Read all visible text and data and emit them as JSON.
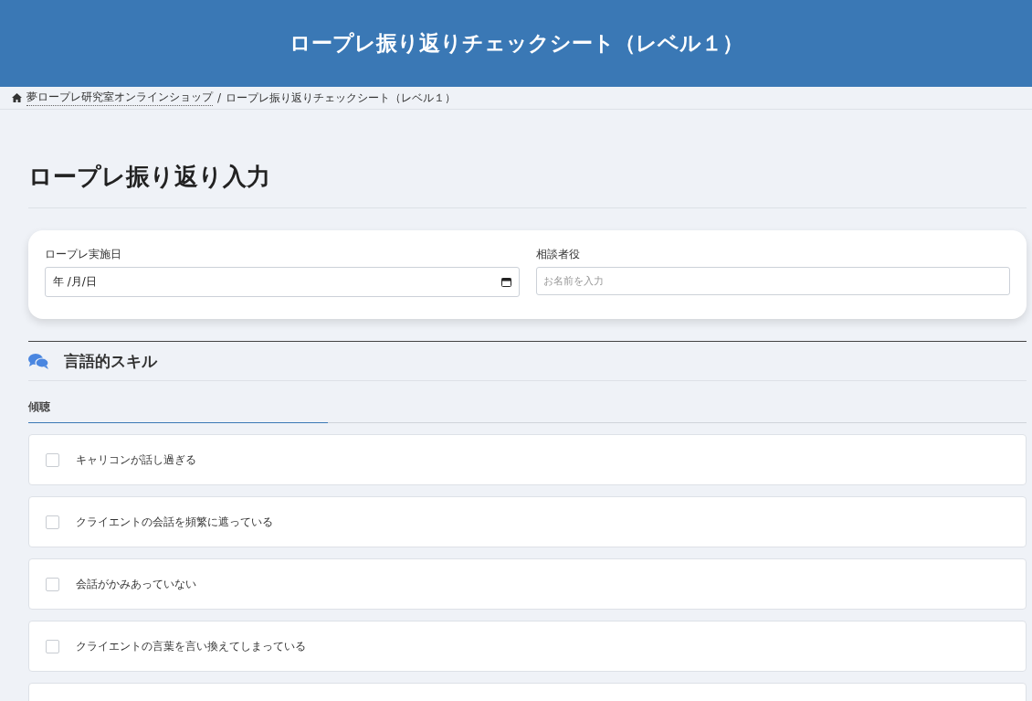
{
  "header": {
    "title": "ロープレ振り返りチェックシート（レベル１）"
  },
  "breadcrumb": {
    "items": [
      {
        "label": "夢ロープレ研究室オンラインショップ",
        "kind": "link"
      },
      {
        "label": "ロープレ振り返りチェックシート（レベル１）",
        "kind": "current"
      }
    ],
    "separator": "/"
  },
  "page_title": "ロープレ振り返り入力",
  "form": {
    "date": {
      "label": "ロープレ実施日",
      "value": "年 /月/日"
    },
    "role": {
      "label": "相談者役",
      "placeholder": "お名前を入力"
    }
  },
  "section": {
    "title": "言語的スキル",
    "subsection": "傾聴",
    "items": [
      {
        "kind": "row",
        "label": "キャリコンが話し過ぎる",
        "checked": false
      },
      {
        "kind": "row",
        "label": "クライエントの会話を頻繁に遮っている",
        "checked": false
      },
      {
        "kind": "row",
        "label": "会話がかみあっていない",
        "checked": false
      },
      {
        "kind": "row",
        "label": "クライエントの言葉を言い換えてしまっている",
        "checked": false
      },
      {
        "kind": "cut"
      }
    ]
  }
}
